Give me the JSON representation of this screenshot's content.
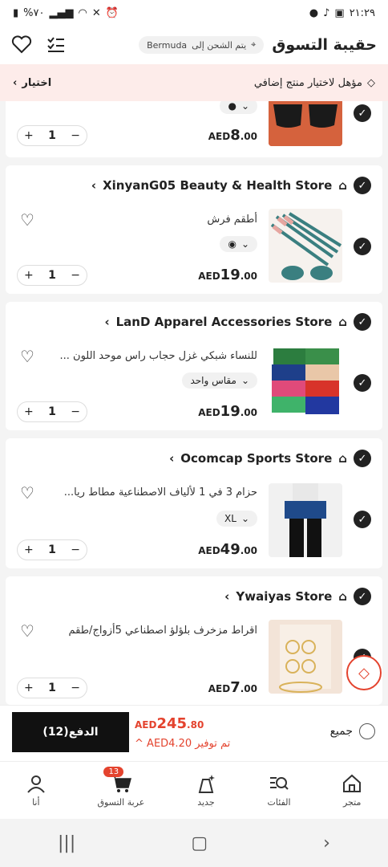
{
  "status_bar": {
    "time": "٢١:٢٩",
    "battery": "%٧٠"
  },
  "header": {
    "title": "حقيبة التسوق",
    "ship_label": "يتم الشحن إلى",
    "ship_country": "Bermuda"
  },
  "promo": {
    "message": "مؤهل لاختيار منتج إضافي",
    "choose_label": "اختيار"
  },
  "cards": [
    {
      "store": "",
      "product": "",
      "variant": "",
      "price_currency": "AED",
      "price_int": "8",
      "price_dec": ".00",
      "qty": "1"
    },
    {
      "store": "XinyanG05 Beauty & Health Store",
      "product": "أطقم فرش",
      "variant": "",
      "price_currency": "AED",
      "price_int": "19",
      "price_dec": ".00",
      "qty": "1"
    },
    {
      "store": "LanD Apparel Accessories Store",
      "product": "للنساء شبكي غزل حجاب راس موحد اللون ...",
      "variant": "مقاس واحد",
      "price_currency": "AED",
      "price_int": "19",
      "price_dec": ".00",
      "qty": "1"
    },
    {
      "store": "Ocomcap Sports Store",
      "product": "حزام 3 في 1 لألياف الاصطناعية مطاط ريا...",
      "variant": "XL",
      "price_currency": "AED",
      "price_int": "49",
      "price_dec": ".00",
      "qty": "1"
    },
    {
      "store": "Ywaiyas Store",
      "product": "اقراط مزخرف بلؤلؤ اصطناعي 5أزواج/طقم",
      "variant": "",
      "price_currency": "AED",
      "price_int": "7",
      "price_dec": ".00",
      "qty": "1"
    }
  ],
  "checkout": {
    "pay_label": "الدفع(12)",
    "total_currency": "AED",
    "total_int": "245",
    "total_dec": ".80",
    "save_label": "تم توفير",
    "save_value": "AED4.20",
    "all_label": "جميع"
  },
  "tabs": [
    {
      "label": "متجر",
      "icon": "home-icon"
    },
    {
      "label": "الفئات",
      "icon": "categories-icon"
    },
    {
      "label": "جديد",
      "icon": "new-icon"
    },
    {
      "label": "عربة التسوق",
      "icon": "cart-icon",
      "badge": "13"
    },
    {
      "label": "أنا",
      "icon": "user-icon"
    }
  ],
  "accent": "#e4432e"
}
